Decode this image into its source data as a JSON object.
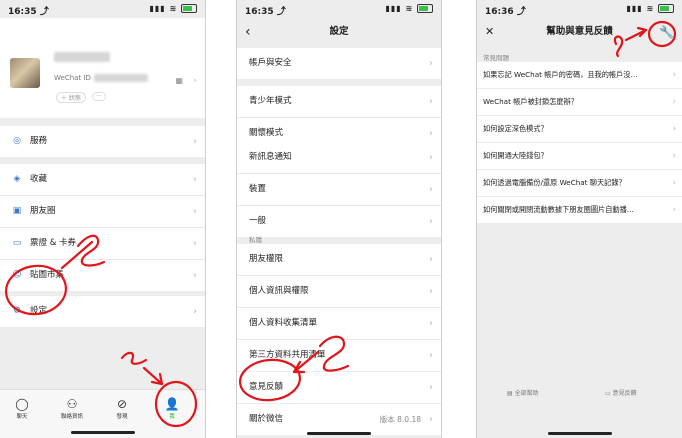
{
  "phone1": {
    "status": {
      "time": "16:35 ⤴",
      "signal": "▮▮▮ ≋"
    },
    "profile": {
      "wechat_id_label": "WeChat ID",
      "status_pill": "＋ 狀態",
      "more_pill": "···"
    },
    "menu": [
      {
        "icon": "◎",
        "label": "服務"
      },
      {
        "icon": "◈",
        "label": "收藏"
      },
      {
        "icon": "▣",
        "label": "朋友圈"
      },
      {
        "icon": "▭",
        "label": "票證 & 卡券"
      },
      {
        "icon": "☺",
        "label": "貼圖市集"
      },
      {
        "icon": "⚙",
        "label": "設定"
      }
    ],
    "tabs": [
      {
        "icon": "◯",
        "label": "聊天",
        "icon_name": "chat-icon"
      },
      {
        "icon": "⚇",
        "label": "聯絡資訊",
        "icon_name": "contacts-icon"
      },
      {
        "icon": "⊘",
        "label": "發現",
        "icon_name": "discover-icon"
      },
      {
        "icon": "👤",
        "label": "我",
        "icon_name": "me-icon"
      }
    ]
  },
  "phone2": {
    "status": {
      "time": "16:35 ⤴",
      "signal": "▮▮▮ ≋"
    },
    "title": "設定",
    "back": "‹",
    "group1": [
      "帳戶與安全"
    ],
    "group2": [
      "青少年模式",
      "關懷模式"
    ],
    "group3": [
      "新訊息通知",
      "裝置",
      "一般"
    ],
    "privacy_header": "私隱",
    "group4": [
      "朋友權限",
      "個人資訊與權限",
      "個人資料收集清單",
      "第三方資料共用清單"
    ],
    "group5": [
      "意見反饋"
    ],
    "about": {
      "label": "關於微信",
      "version": "版本 8.0.18"
    }
  },
  "phone3": {
    "status": {
      "time": "16:36 ⤴",
      "signal": "▮▮▮ ≋"
    },
    "title": "幫助與意見反饋",
    "close": "✕",
    "tool": "🔧",
    "faq_header": "常見問題",
    "questions": [
      "如果忘記 WeChat 帳戶的密碼，且我的帳戶沒…",
      "WeChat 帳戶被封鎖怎麼辦？",
      "如何設定深色模式？",
      "如何開通大陸錢包？",
      "如何透過電腦備份/還原 WeChat 聊天記錄？",
      "如何關閉或開閉流動數據下朋友圈圖片自動播…"
    ],
    "bottom": {
      "all_help": "全部幫助",
      "feedback": "意見反饋"
    }
  },
  "colors": {
    "accent_green": "#1aad19",
    "annotation_red": "#e0161b"
  }
}
